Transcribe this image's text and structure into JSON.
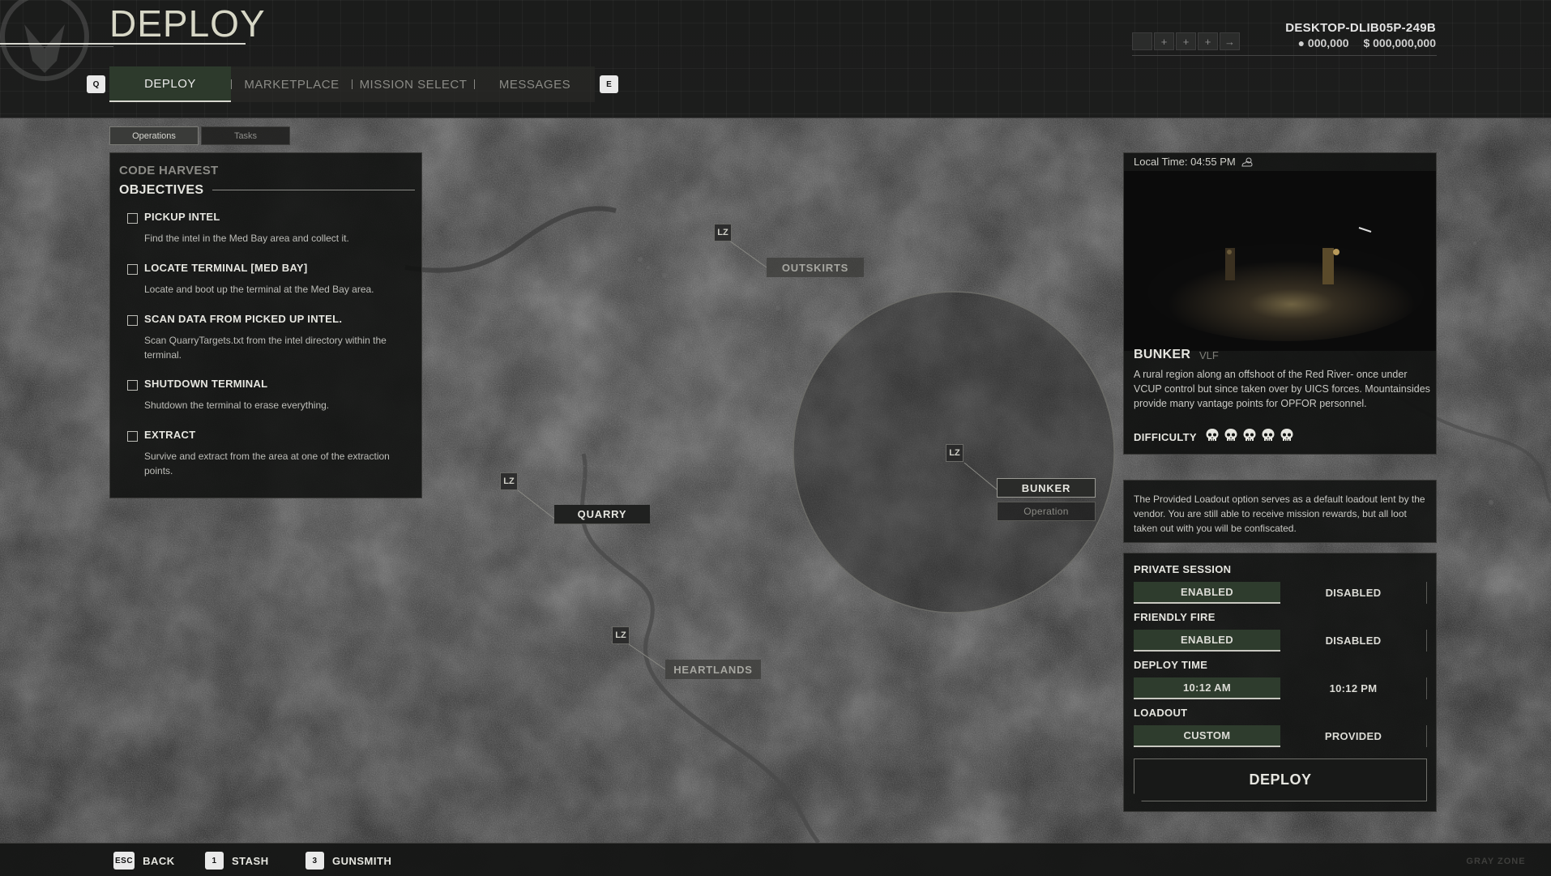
{
  "header": {
    "title": "DEPLOY",
    "nav_prev_key": "Q",
    "nav_next_key": "E",
    "tabs": [
      {
        "label": "DEPLOY",
        "active": true
      },
      {
        "label": "MARKETPLACE",
        "active": false
      },
      {
        "label": "MISSION SELECT",
        "active": false
      },
      {
        "label": "MESSAGES",
        "active": false
      }
    ],
    "machine_name": "DESKTOP-DLIB05P-249B",
    "currency_a": "000,00",
    "currency_a_last": "0",
    "currency_b_prefix": "$",
    "currency_b": "000,000,00",
    "currency_b_last": "0",
    "slot_arrow": "→",
    "slot_add": "+"
  },
  "left_panel": {
    "subtabs": [
      {
        "label": "Operations",
        "active": true
      },
      {
        "label": "Tasks",
        "active": false
      }
    ],
    "operation_name": "CODE HARVEST",
    "objectives_heading": "OBJECTIVES",
    "objectives": [
      {
        "title": "PICKUP INTEL",
        "desc": "Find the intel in the Med Bay area and collect it."
      },
      {
        "title": "LOCATE TERMINAL [MED BAY]",
        "desc": "Locate and boot up the terminal at the Med Bay area."
      },
      {
        "title": "SCAN DATA FROM PICKED UP INTEL.",
        "desc": "Scan QuarryTargets.txt from the intel directory within the terminal."
      },
      {
        "title": "SHUTDOWN TERMINAL",
        "desc": "Shutdown the terminal to erase everything."
      },
      {
        "title": "EXTRACT",
        "desc": "Survive and extract from the area at one of the extraction points."
      }
    ]
  },
  "map": {
    "lz_label": "LZ",
    "locations": {
      "quarry": "QUARRY",
      "outskirts": "OUTSKIRTS",
      "heartlands": "HEARTLANDS",
      "bunker": "BUNKER",
      "bunker_type": "Operation"
    }
  },
  "location_card": {
    "local_time": "Local Time: 04:55 PM",
    "weather_icon": "cloud-sun-icon",
    "name": "BUNKER",
    "code": "VLF",
    "description": "A rural region along an offshoot of the Red River- once under VCUP control but since taken over by UICS forces. Mountainsides provide many vantage points for OPFOR personnel.",
    "difficulty_label": "DIFFICULTY",
    "difficulty_level": 5,
    "difficulty_max": 5
  },
  "loadout_note": "The Provided Loadout option serves as a default loadout lent by the vendor. You are still able to receive mission rewards, but all loot taken out with you will be confiscated.",
  "settings": {
    "private_session": {
      "label": "PRIVATE SESSION",
      "options": [
        "ENABLED",
        "DISABLED"
      ],
      "selected": "ENABLED"
    },
    "friendly_fire": {
      "label": "FRIENDLY FIRE",
      "options": [
        "ENABLED",
        "DISABLED"
      ],
      "selected": "ENABLED"
    },
    "deploy_time": {
      "label": "DEPLOY TIME",
      "options": [
        "10:12 AM",
        "10:12 PM"
      ],
      "selected": "10:12 AM"
    },
    "loadout": {
      "label": "LOADOUT",
      "options": [
        "CUSTOM",
        "PROVIDED"
      ],
      "selected": "CUSTOM"
    },
    "deploy_label": "DEPLOY"
  },
  "footer": {
    "back": {
      "key": "ESC",
      "label": "BACK"
    },
    "stash": {
      "key": "1",
      "label": "STASH"
    },
    "gunsmith": {
      "key": "3",
      "label": "GUNSMITH"
    },
    "brand": "GRAY ZONE"
  },
  "colors": {
    "accent_green": "#2e3c2d",
    "panel_bg": "#101110",
    "text_primary": "#e6e6e0",
    "text_dim": "#8b8b86"
  }
}
